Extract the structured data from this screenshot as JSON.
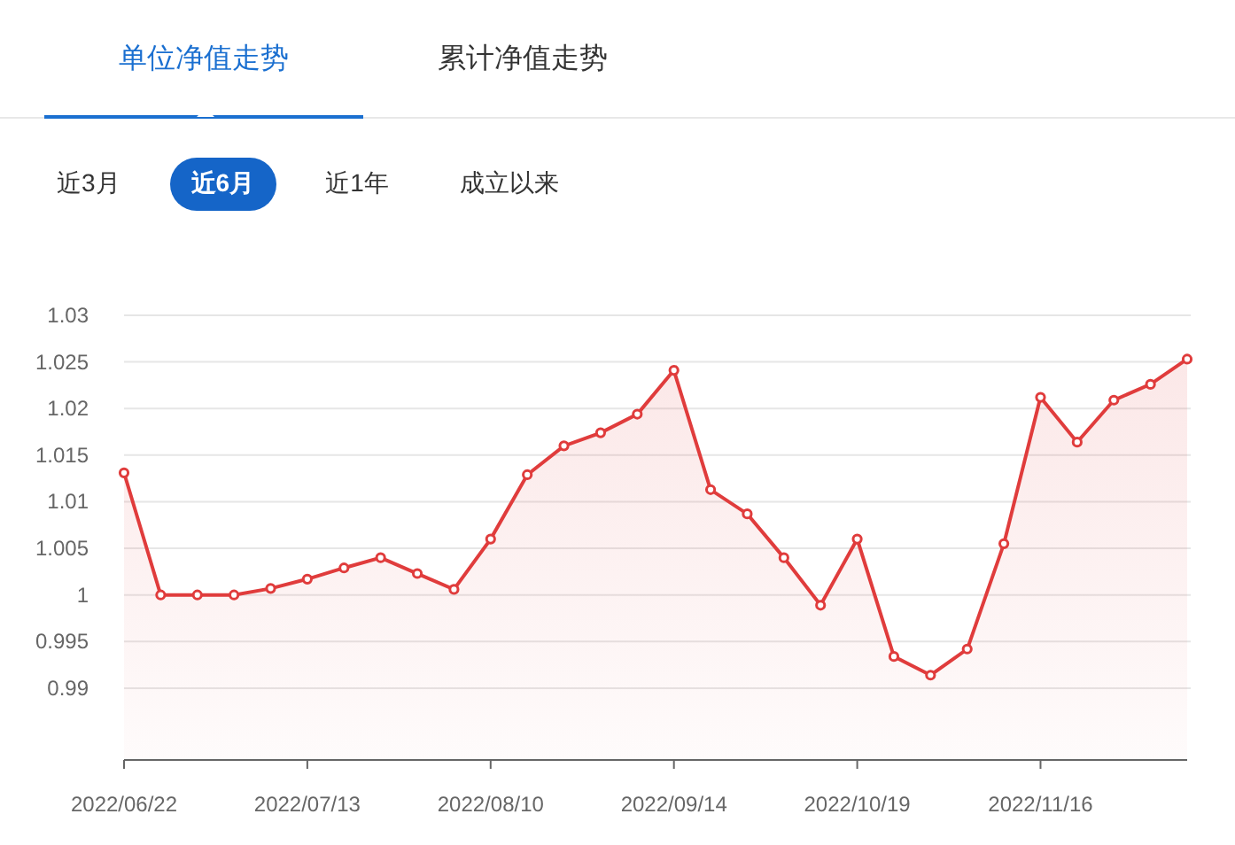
{
  "tabs": [
    {
      "label": "单位净值走势",
      "selected": true
    },
    {
      "label": "累计净值走势",
      "selected": false
    }
  ],
  "ranges": [
    {
      "label": "近3月",
      "selected": false
    },
    {
      "label": "近6月",
      "selected": true
    },
    {
      "label": "近1年",
      "selected": false
    },
    {
      "label": "成立以来",
      "selected": false
    }
  ],
  "chart": {
    "chart_data": {
      "type": "area",
      "categories": [
        "2022/06/22",
        null,
        null,
        null,
        null,
        "2022/07/13",
        null,
        null,
        null,
        null,
        "2022/08/10",
        null,
        null,
        null,
        null,
        "2022/09/14",
        null,
        null,
        null,
        null,
        "2022/10/19",
        null,
        null,
        null,
        null,
        "2022/11/16",
        null,
        null,
        null,
        null
      ],
      "series": [
        {
          "color": "#e03c3c",
          "values": [
            1.0131,
            1.0,
            1.0,
            1.0,
            1.0007,
            1.0017,
            1.0029,
            1.004,
            1.0023,
            1.0006,
            1.006,
            1.0129,
            1.016,
            1.0174,
            1.0194,
            1.0241,
            1.0113,
            1.0087,
            1.004,
            0.9989,
            1.006,
            0.9934,
            0.9914,
            0.9942,
            1.0055,
            1.0212,
            1.0164,
            1.0209,
            1.0226,
            1.0253
          ]
        }
      ],
      "ylim": [
        0.9823,
        1.03
      ],
      "grid": true,
      "yticks": [
        {
          "value": 0.99,
          "label": "0.99"
        },
        {
          "value": 0.995,
          "label": "0.995"
        },
        {
          "value": 1,
          "label": "1"
        },
        {
          "value": 1.005,
          "label": "1.005"
        },
        {
          "value": 1.01,
          "label": "1.01"
        },
        {
          "value": 1.015,
          "label": "1.015"
        },
        {
          "value": 1.02,
          "label": "1.02"
        },
        {
          "value": 1.025,
          "label": "1.025"
        },
        {
          "value": 1.03,
          "label": "1.03"
        }
      ]
    }
  }
}
